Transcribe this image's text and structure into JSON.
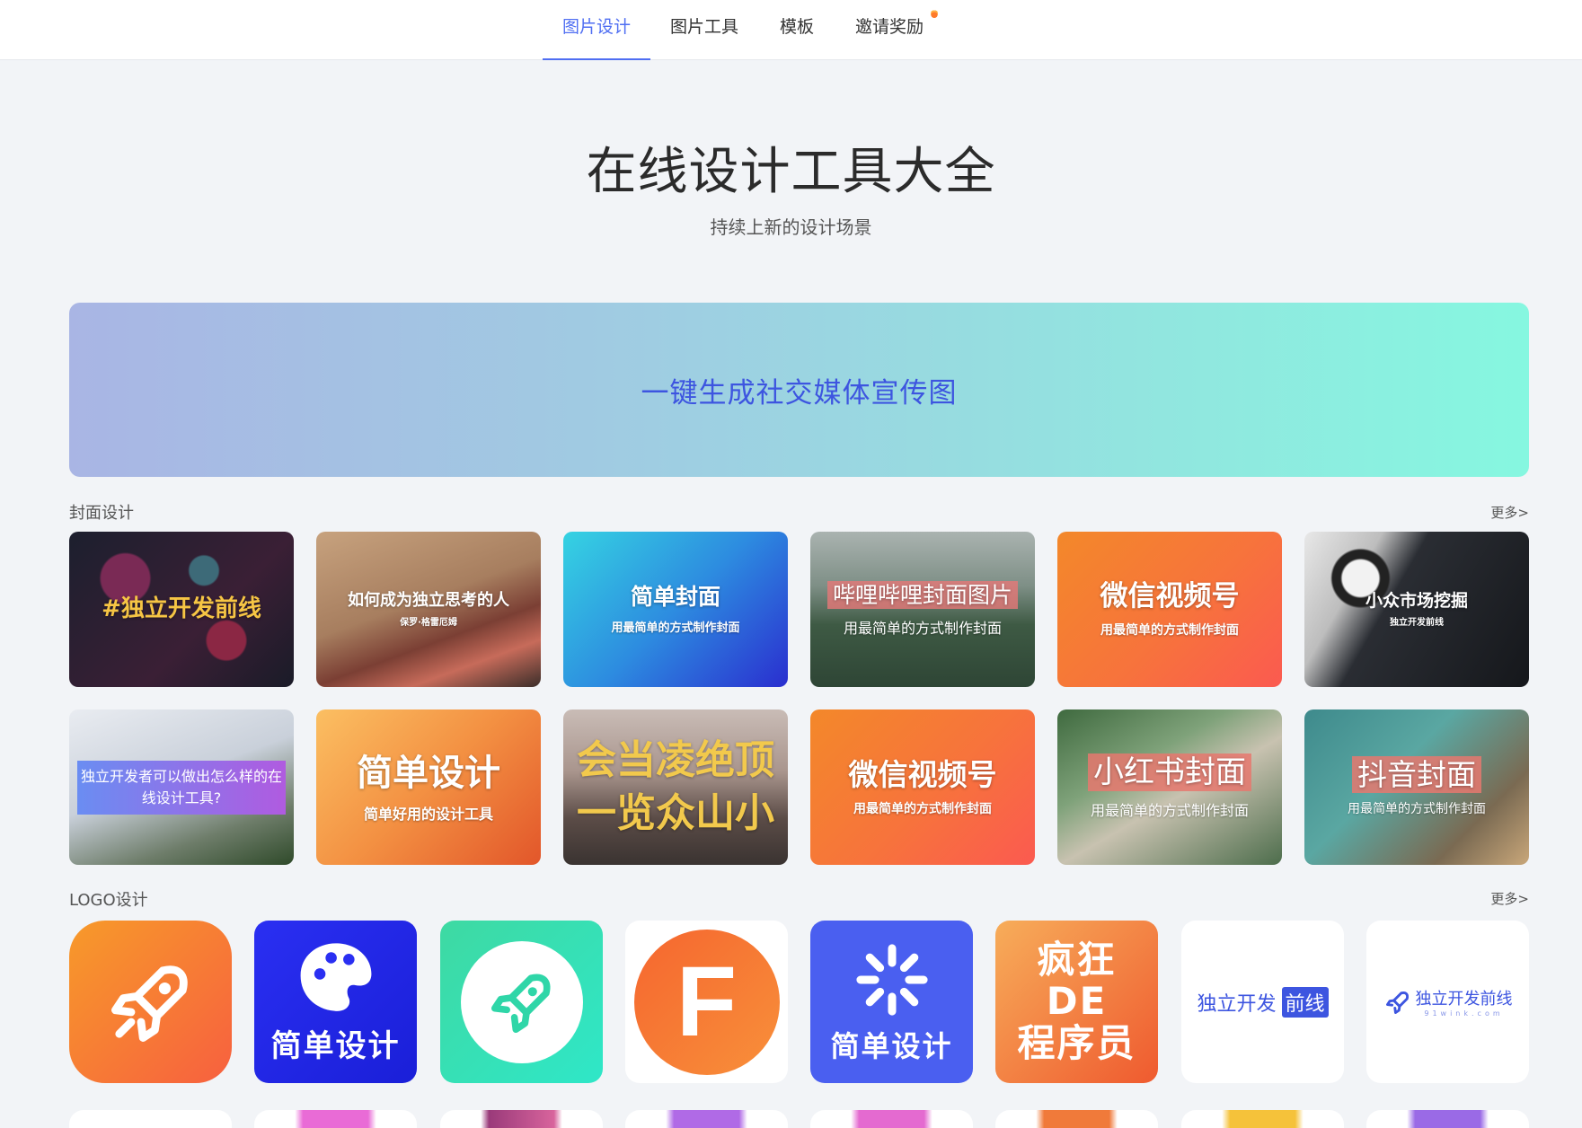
{
  "nav": {
    "items": [
      {
        "label": "图片设计",
        "active": true
      },
      {
        "label": "图片工具",
        "active": false
      },
      {
        "label": "模板",
        "active": false
      },
      {
        "label": "邀请奖励",
        "active": false,
        "badge_icon": "fire-icon"
      }
    ],
    "accent_color": "#4f6ef2"
  },
  "hero": {
    "title": "在线设计工具大全",
    "subtitle": "持续上新的设计场景"
  },
  "banner": {
    "label": "一键生成社交媒体宣传图"
  },
  "cover_section": {
    "title": "封面设计",
    "more": "更多>",
    "cards": [
      {
        "title": "#独立开发前线",
        "subtitle": ""
      },
      {
        "title": "如何成为独立思考的人",
        "subtitle": "保罗·格雷厄姆"
      },
      {
        "title": "简单封面",
        "subtitle": "用最简单的方式制作封面"
      },
      {
        "title": "哔哩哔哩封面图片",
        "subtitle": "用最简单的方式制作封面"
      },
      {
        "title": "微信视频号",
        "subtitle": "用最简单的方式制作封面"
      },
      {
        "title": "小众市场挖掘",
        "subtitle": "独立开发前线"
      },
      {
        "title": "独立开发者可以做出怎么样的在线设计工具?",
        "subtitle": ""
      },
      {
        "title": "简单设计",
        "subtitle": "简单好用的设计工具"
      },
      {
        "title": "会当凌绝顶",
        "subtitle": "一览众山小"
      },
      {
        "title": "微信视频号",
        "subtitle": "用最简单的方式制作封面"
      },
      {
        "title": "小红书封面",
        "subtitle": "用最简单的方式制作封面"
      },
      {
        "title": "抖音封面",
        "subtitle": "用最简单的方式制作封面"
      }
    ]
  },
  "logo_section": {
    "title": "LOGO设计",
    "more": "更多>",
    "logos": [
      {
        "icon": "rocket-icon",
        "text": ""
      },
      {
        "icon": "palette-icon",
        "text": "简单设计"
      },
      {
        "icon": "rocket-icon",
        "text": ""
      },
      {
        "icon": "letter-f-icon",
        "text": "F"
      },
      {
        "icon": "sparkle-icon",
        "text": "简单设计"
      },
      {
        "icon": "",
        "text": "疯狂DE程序员",
        "lines": [
          "疯狂",
          "DE",
          "程序员"
        ]
      },
      {
        "icon": "",
        "text": "独立开发",
        "highlight": "前线"
      },
      {
        "icon": "rocket-icon",
        "text": "独立开发前线",
        "sub": "91wink.com"
      }
    ]
  }
}
